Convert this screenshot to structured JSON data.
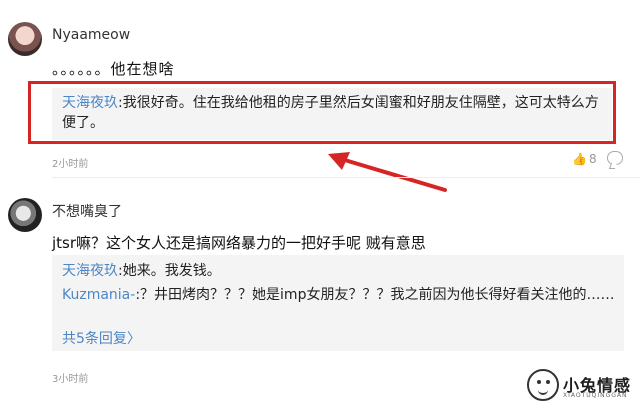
{
  "comments": [
    {
      "username": "Nyaameow",
      "text": "。。。。。。他在想啥",
      "reply": {
        "author": "天海夜玖",
        "text": ":我很好奇。住在我给他租的房子里然后女闺蜜和好朋友住隔壁，这可太特么方便了。"
      },
      "timestamp": "2小时前",
      "likes": "8"
    },
    {
      "username": "不想嘴臭了",
      "text": "jtsr嘛？这个女人还是搞网络暴力的一把好手呢 贼有意思",
      "replies": [
        {
          "author": "天海夜玖",
          "text": ":她来。我发钱。"
        },
        {
          "author": "Kuzmania-",
          "text": ":？井田烤肉？？？她是imp女朋友？？？我之前因为他长得好看关注他的……"
        }
      ],
      "more_replies": "共5条回复",
      "more_icon": "chevron-right-icon",
      "timestamp": "3小时前"
    }
  ],
  "annotation": {
    "frame_color": "#d62525",
    "arrow_color": "#d62525"
  },
  "watermark": {
    "text": "小兔情感",
    "sub": "XIAOTUQINGGAN"
  },
  "colors": {
    "link": "#4e86c4",
    "meta": "#999999",
    "reply_bg": "#f4f4f4"
  }
}
